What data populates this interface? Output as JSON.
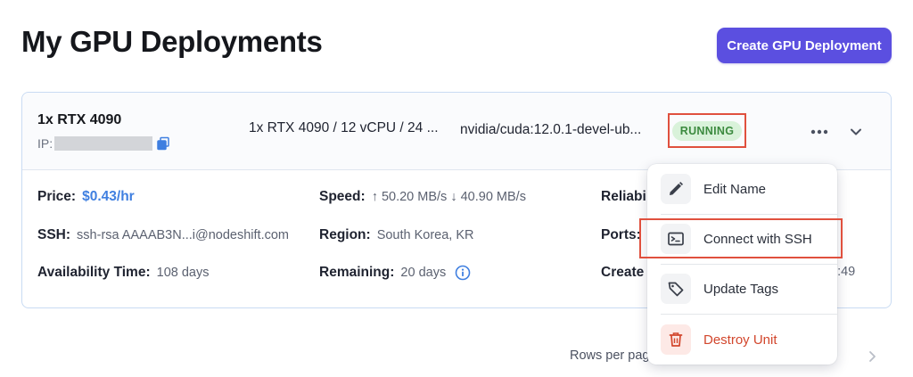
{
  "header": {
    "title": "My GPU Deployments",
    "create_button": "Create GPU Deployment"
  },
  "deployment": {
    "gpu_name": "1x RTX 4090",
    "ip_label": "IP:",
    "spec": "1x RTX 4090 / 12 vCPU / 24 ...",
    "image": "nvidia/cuda:12.0.1-devel-ub...",
    "status": "RUNNING",
    "details": {
      "price_label": "Price:",
      "price_value": "$0.43/hr",
      "speed_label": "Speed:",
      "speed_value": "↑ 50.20 MB/s ↓ 40.90 MB/s",
      "reliability_label": "Reliabi",
      "ssh_label": "SSH:",
      "ssh_value": "ssh-rsa AAAAB3N...i@nodeshift.com",
      "region_label": "Region:",
      "region_value": "South Korea, KR",
      "ports_label": "Ports:",
      "availability_label": "Availability Time:",
      "availability_value": "108 days",
      "remaining_label": "Remaining:",
      "remaining_value": "20 days",
      "created_label": "Create",
      "created_value_partial": "2:49"
    }
  },
  "context_menu": {
    "items": [
      {
        "label": "Edit Name",
        "icon": "pencil-icon"
      },
      {
        "label": "Connect with SSH",
        "icon": "terminal-icon"
      },
      {
        "label": "Update Tags",
        "icon": "tag-icon"
      },
      {
        "label": "Destroy Unit",
        "icon": "trash-icon"
      }
    ]
  },
  "pagination": {
    "rows_per_page_label": "Rows per pag"
  },
  "colors": {
    "accent": "#5b4fe0",
    "price": "#3f7fe0",
    "running_bg": "#d9f2da",
    "running_text": "#3c8a3f",
    "danger": "#d2462c",
    "highlight": "#e0503e"
  }
}
